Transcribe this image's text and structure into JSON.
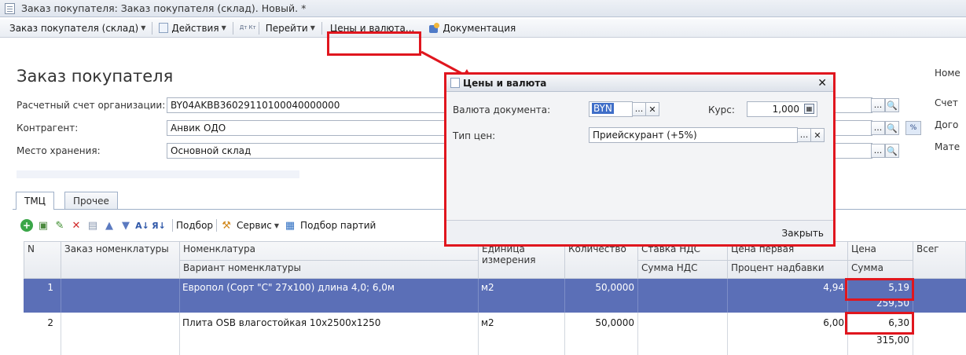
{
  "window": {
    "title": "Заказ покупателя: Заказ покупателя (склад). Новый. *"
  },
  "toolbar": {
    "doc_type": "Заказ покупателя (склад)",
    "actions": "Действия",
    "dtkt": "Дт Кт",
    "goto": "Перейти",
    "prices": "Цены и валюта...",
    "docs": "Документация"
  },
  "form": {
    "title": "Заказ покупателя",
    "account_label": "Расчетный счет организации:",
    "account_value": "BY04AKBB36029110100040000000",
    "contractor_label": "Контрагент:",
    "contractor_value": "Анвик ОДО",
    "storage_label": "Место хранения:",
    "storage_value": "Основной склад",
    "right_no": "Номе",
    "right_acc": "Счет",
    "right_contract": "Дого",
    "right_mat": "Мате"
  },
  "tabs": [
    "ТМЦ",
    "Прочее"
  ],
  "table_toolbar": {
    "selection": "Подбор",
    "service": "Сервис",
    "batch": "Подбор партий"
  },
  "grid": {
    "headers": {
      "n": "N",
      "order_nom": "Заказ номенклатуры",
      "nom": "Номенклатура",
      "nom_variant": "Вариант номенклатуры",
      "unit": "Единица измерения",
      "qty": "Количество",
      "vat_rate": "Ставка НДС",
      "vat_sum": "Сумма НДС",
      "first_price": "Цена первая",
      "markup": "Процент надбавки",
      "price": "Цена",
      "sum": "Сумма",
      "total": "Всег"
    },
    "rows": [
      {
        "n": "1",
        "nom": "Европол (Сорт \"С\" 27х100) длина 4,0; 6,0м",
        "unit": "м2",
        "qty": "50,0000",
        "first_price": "4,94",
        "price": "5,19",
        "sum": "259,50"
      },
      {
        "n": "2",
        "nom": "Плита OSB влагостойкая 10х2500х1250",
        "unit": "м2",
        "qty": "50,0000",
        "first_price": "6,00",
        "price": "6,30",
        "sum": "315,00"
      }
    ]
  },
  "dialog": {
    "title": "Цены и валюта",
    "currency_label": "Валюта документа:",
    "currency_value": "BYN",
    "rate_label": "Курс:",
    "rate_value": "1,000",
    "price_type_label": "Тип цен:",
    "price_type_value": "Приейскурант (+5%)",
    "close": "Закрыть"
  },
  "colors": {
    "highlight_row": "#5b6fb7",
    "callout": "#e0161e"
  }
}
